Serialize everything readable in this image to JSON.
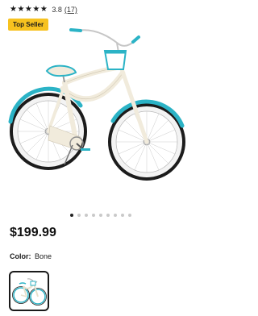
{
  "rating": {
    "stars_text": "★★★★★",
    "value": "3.8",
    "count": "(17)",
    "score": 3.8
  },
  "badge": {
    "label": "Top Seller"
  },
  "product": {
    "image_icon": "bicycle-image",
    "image_slides": 9,
    "active_slide": 1
  },
  "price": "$199.99",
  "color": {
    "label": "Color:",
    "value": "Bone"
  },
  "colors": {
    "frame": "#f1ebdc",
    "accent": "#2bb3c6",
    "badge": "#f7c21f"
  }
}
